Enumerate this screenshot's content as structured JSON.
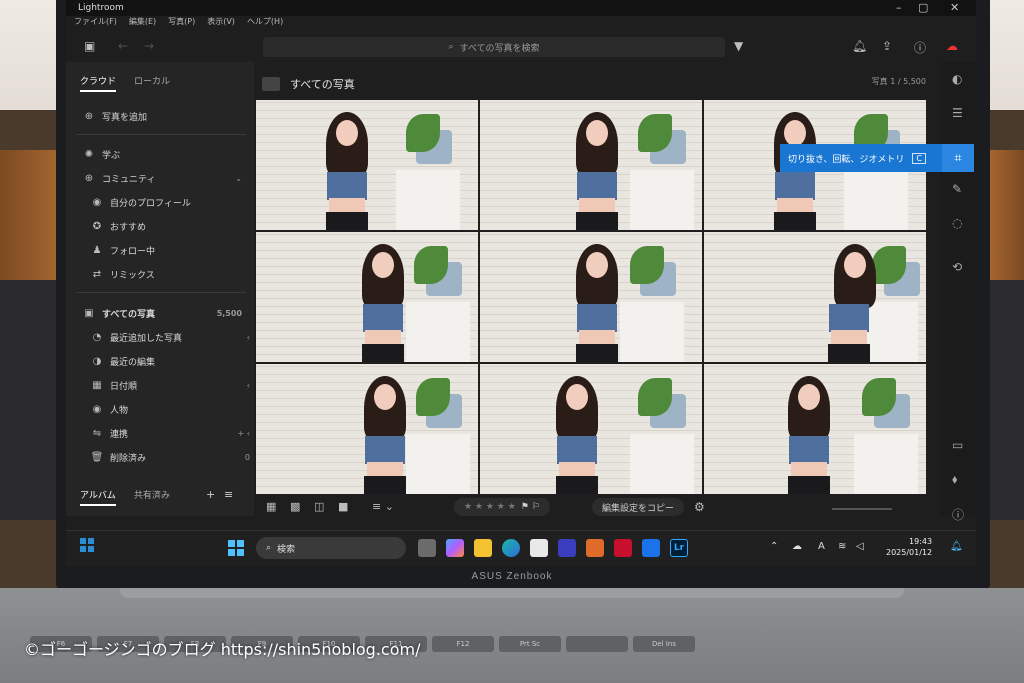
{
  "app": {
    "title": "Lightroom"
  },
  "menu": [
    "ファイル(F)",
    "編集(E)",
    "写真(P)",
    "表示(V)",
    "ヘルプ(H)"
  ],
  "search": {
    "placeholder": "すべての写真を検索"
  },
  "left_panel": {
    "tabs": [
      "クラウド",
      "ローカル"
    ],
    "add_photos": "写真を追加",
    "learn": "学ぶ",
    "community": "コミュニティ",
    "community_items": [
      "自分のプロフィール",
      "おすすめ",
      "フォロー中",
      "リミックス"
    ],
    "all_photos": "すべての写真",
    "all_photos_count": "5,500",
    "library_items": [
      "最近追加した写真",
      "最近の編集",
      "日付順",
      "人物",
      "連携",
      "削除済み"
    ],
    "deleted_count": "0",
    "albums_tabs": [
      "アルバム",
      "共有済み"
    ]
  },
  "main": {
    "title": "すべての写真",
    "count": "写真 1 / 5,500",
    "tooltip": {
      "text": "切り抜き、回転、ジオメトリ",
      "shortcut": "C"
    },
    "copy_settings": "編集設定をコピー",
    "rating_stars": "★ ★ ★ ★ ★"
  },
  "taskbar": {
    "search": "検索",
    "time": "19:43",
    "date": "2025/01/12",
    "lr_label": "Lr",
    "ime": "A"
  },
  "device": {
    "brand": "ASUS Zenbook"
  },
  "keyboard_keys": [
    "F6",
    "F7",
    "F8",
    "F9",
    "F10",
    "F11",
    "F12",
    "Prt Sc",
    "",
    "Del Ins"
  ],
  "watermark": "©ゴーゴージンゴのブログ  https://shin5noblog.com/",
  "colors": {
    "accent": "#1976d2",
    "lightroom_blue": "#31a8ff"
  }
}
